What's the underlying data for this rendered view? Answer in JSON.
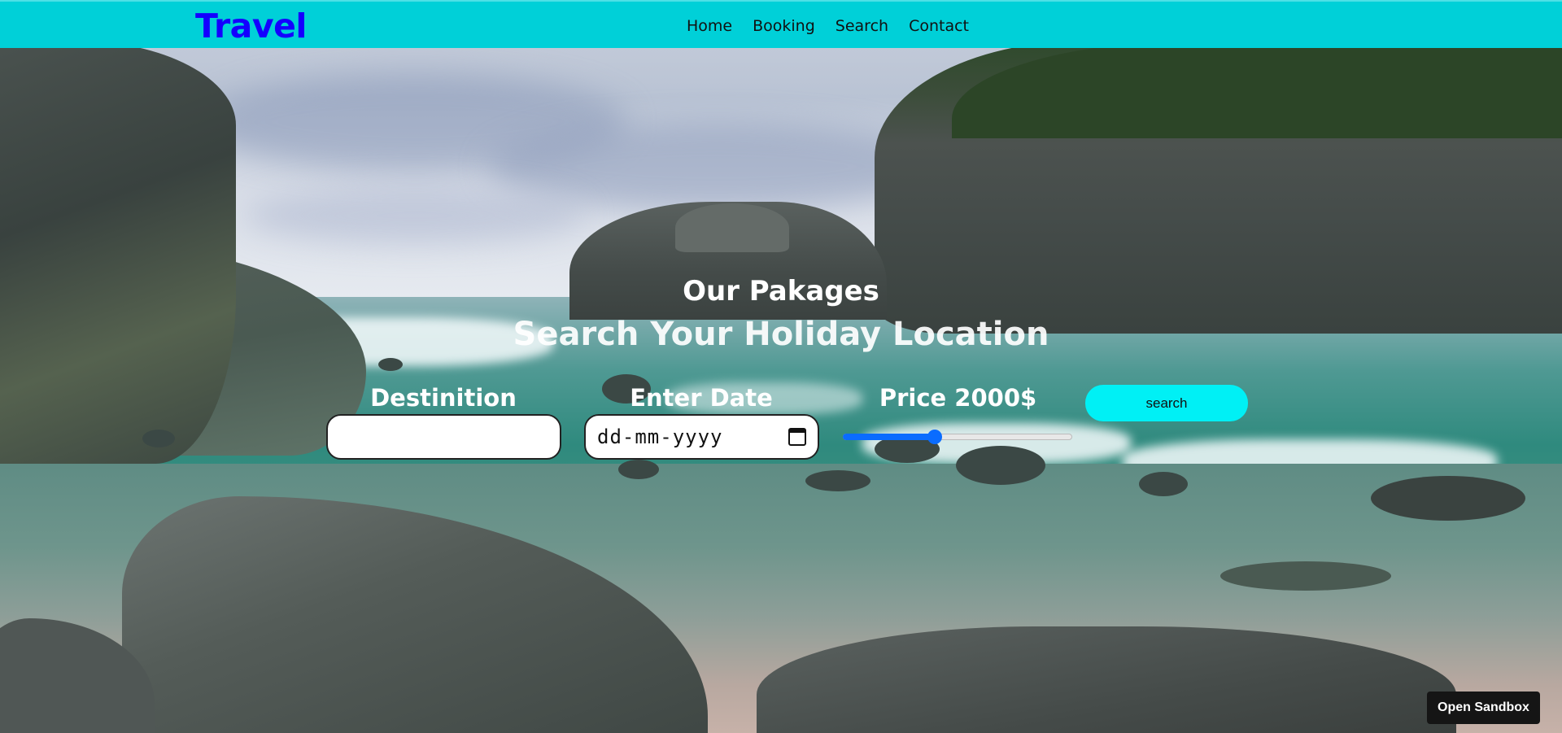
{
  "navbar": {
    "logo": "Travel",
    "links": [
      "Home",
      "Booking",
      "Search",
      "Contact"
    ]
  },
  "hero": {
    "title": "Our Pakages",
    "subtitle": "Search Your Holiday Location"
  },
  "form": {
    "destination_label": "Destinition",
    "destination_value": "",
    "date_label": "Enter Date",
    "date_placeholder": "dd-mm-yyyy",
    "price_label": "Price 2000$",
    "price_slider_fraction": 0.4,
    "search_button": "search"
  },
  "sandbox_button": "Open Sandbox",
  "icons": {
    "date_picker": "calendar-icon"
  },
  "colors": {
    "navbar": "#00d0d8",
    "logo": "#1400ff",
    "search_button": "#00f0f5",
    "slider": "#0a6cff"
  }
}
